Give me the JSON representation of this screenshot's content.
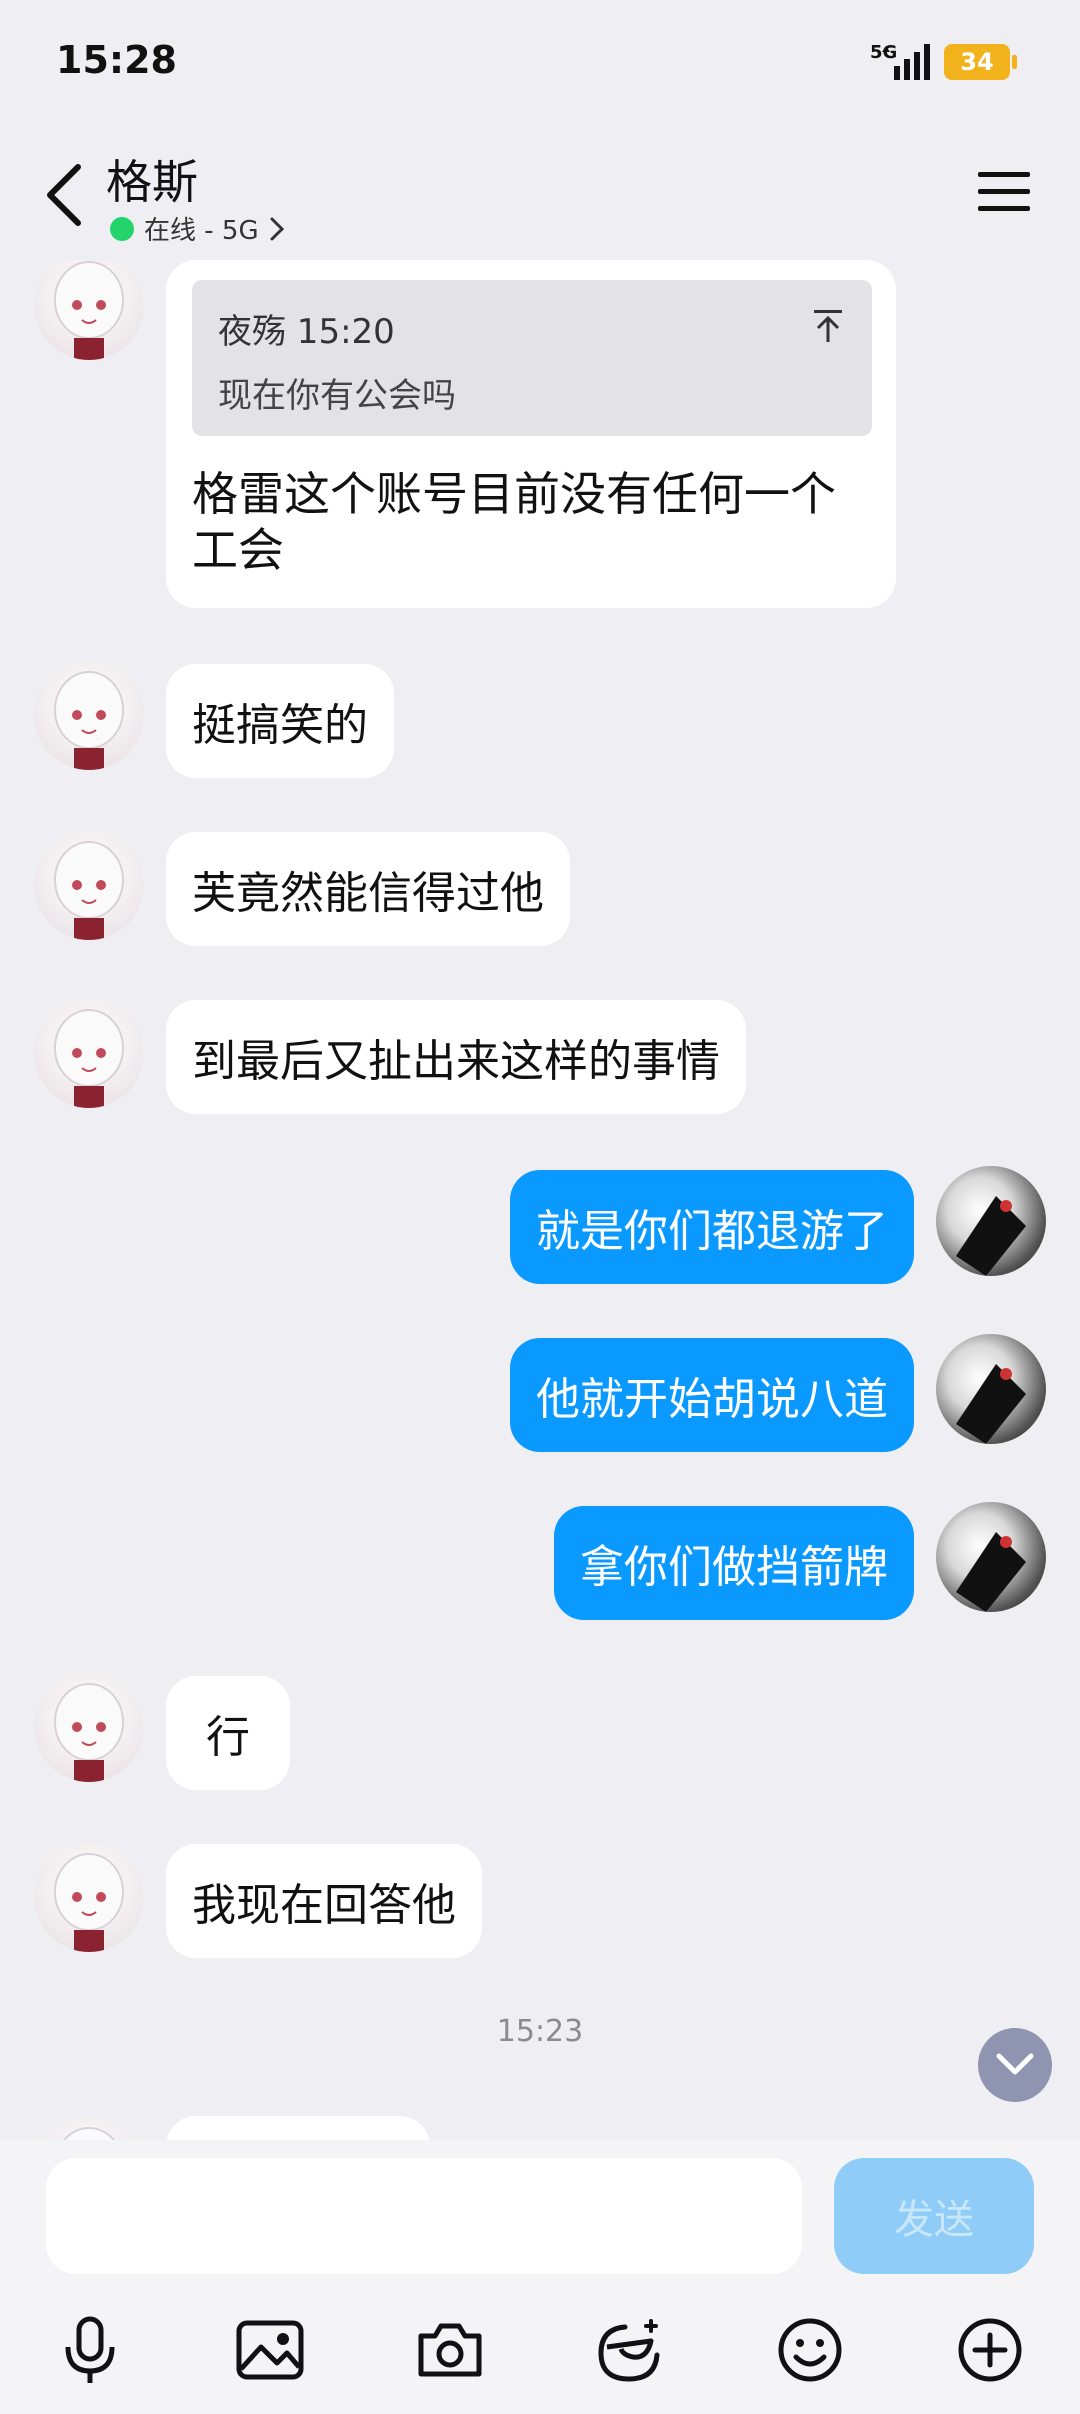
{
  "status_bar": {
    "time": "15:28",
    "network": "5G",
    "battery": "34"
  },
  "header": {
    "title": "格斯",
    "status": "在线 - 5G"
  },
  "messages": {
    "quote": {
      "author_time": "夜殇 15:20",
      "quoted_text": "现在你有公会吗",
      "reply": "格雷这个账号目前没有任何一个工会"
    },
    "m1": "挺搞笑的",
    "m2": "芙竟然能信得过他",
    "m3": "到最后又扯出来这样的事情",
    "m4": "就是你们都退游了",
    "m5": "他就开始胡说八道",
    "m6": "拿你们做挡箭牌",
    "m7": "行",
    "m8": "我现在回答他",
    "timestamp": "15:23"
  },
  "input": {
    "placeholder": "",
    "send_label": "发送"
  },
  "colors": {
    "background": "#efeff3",
    "my_bubble": "#0a99ff",
    "online_dot": "#22d46a",
    "battery": "#f2b21b",
    "send_disabled": "#8fcdf8"
  },
  "toolbar": [
    "microphone-icon",
    "image-icon",
    "camera-icon",
    "sticker-icon",
    "emoji-icon",
    "plus-icon"
  ]
}
